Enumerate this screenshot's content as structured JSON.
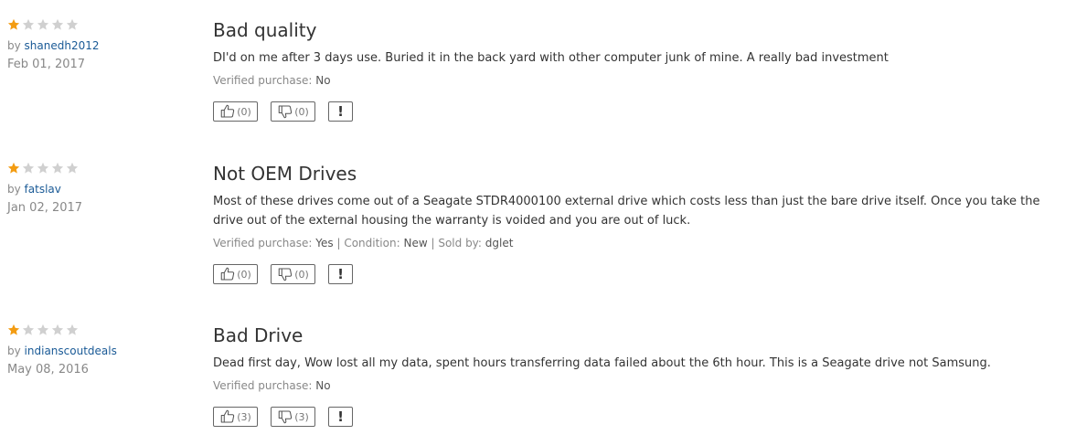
{
  "reviews": [
    {
      "rating": 1,
      "by_label": "by",
      "author": "shanedh2012",
      "date": "Feb 01, 2017",
      "title": "Bad quality",
      "text": "DI'd on me after 3 days use. Buried it in the back yard with other computer junk of mine. A really bad investment",
      "verified_label": "Verified purchase:",
      "verified_value": "No",
      "helpful": "(0)",
      "unhelpful": "(0)",
      "report": "!"
    },
    {
      "rating": 1,
      "by_label": "by",
      "author": "fatslav",
      "date": "Jan 02, 2017",
      "title": "Not OEM Drives",
      "text": "Most of these drives come out of a Seagate STDR4000100 external drive which costs less than just the bare drive itself. Once you take the drive out of the external housing the warranty is voided and you are out of luck.",
      "verified_label": "Verified purchase:",
      "verified_value": "Yes",
      "condition_label": "| Condition:",
      "condition_value": "New",
      "sold_label": "| Sold by:",
      "sold_value": "dglet",
      "helpful": "(0)",
      "unhelpful": "(0)",
      "report": "!"
    },
    {
      "rating": 1,
      "by_label": "by",
      "author": "indianscoutdeals",
      "date": "May 08, 2016",
      "title": "Bad Drive",
      "text": "Dead first day, Wow lost all my data, spent hours transferring data failed about the 6th hour. This is a Seagate drive not Samsung.",
      "verified_label": "Verified purchase:",
      "verified_value": "No",
      "helpful": "(3)",
      "unhelpful": "(3)",
      "report": "!"
    }
  ],
  "colors": {
    "star_filled": "#f39c12",
    "star_empty": "#d0d0d0",
    "author_link": "#1a5a96"
  },
  "icons": {
    "star": "star-icon",
    "thumbs_up": "thumbs-up-icon",
    "thumbs_down": "thumbs-down-icon"
  }
}
